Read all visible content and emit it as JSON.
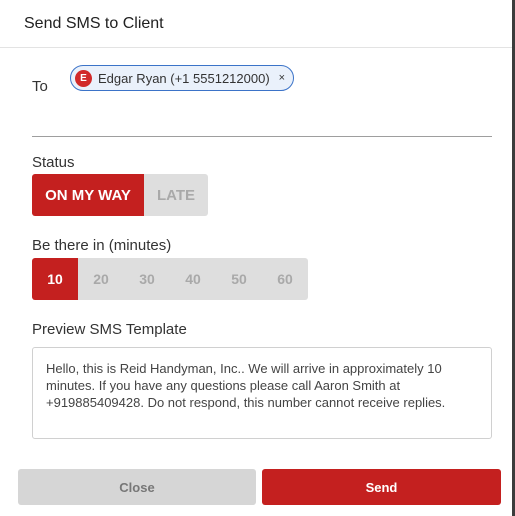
{
  "dialog": {
    "title": "Send SMS to Client"
  },
  "recipient": {
    "label": "To",
    "chip": {
      "avatar_letter": "E",
      "name": "Edgar Ryan (+1 5551212000)",
      "remove_glyph": "×"
    }
  },
  "status": {
    "label": "Status",
    "options": [
      "ON MY WAY",
      "LATE"
    ],
    "selected": "ON MY WAY"
  },
  "eta": {
    "label": "Be there in (minutes)",
    "options": [
      "10",
      "20",
      "30",
      "40",
      "50",
      "60"
    ],
    "selected": "10"
  },
  "preview": {
    "label": "Preview SMS Template",
    "text": "Hello, this is Reid Handyman, Inc.. We will arrive in approximately 10 minutes. If you have any questions please call Aaron Smith at +919885409428. Do not respond, this number cannot receive replies."
  },
  "footer": {
    "close_label": "Close",
    "send_label": "Send"
  },
  "colors": {
    "accent": "#c4201f",
    "chip_border": "#3b73c8",
    "chip_bg": "#eaf1fb",
    "inactive_segment": "#dedede"
  },
  "icons": {
    "chip_remove": "close-icon",
    "chip_avatar": "avatar"
  }
}
